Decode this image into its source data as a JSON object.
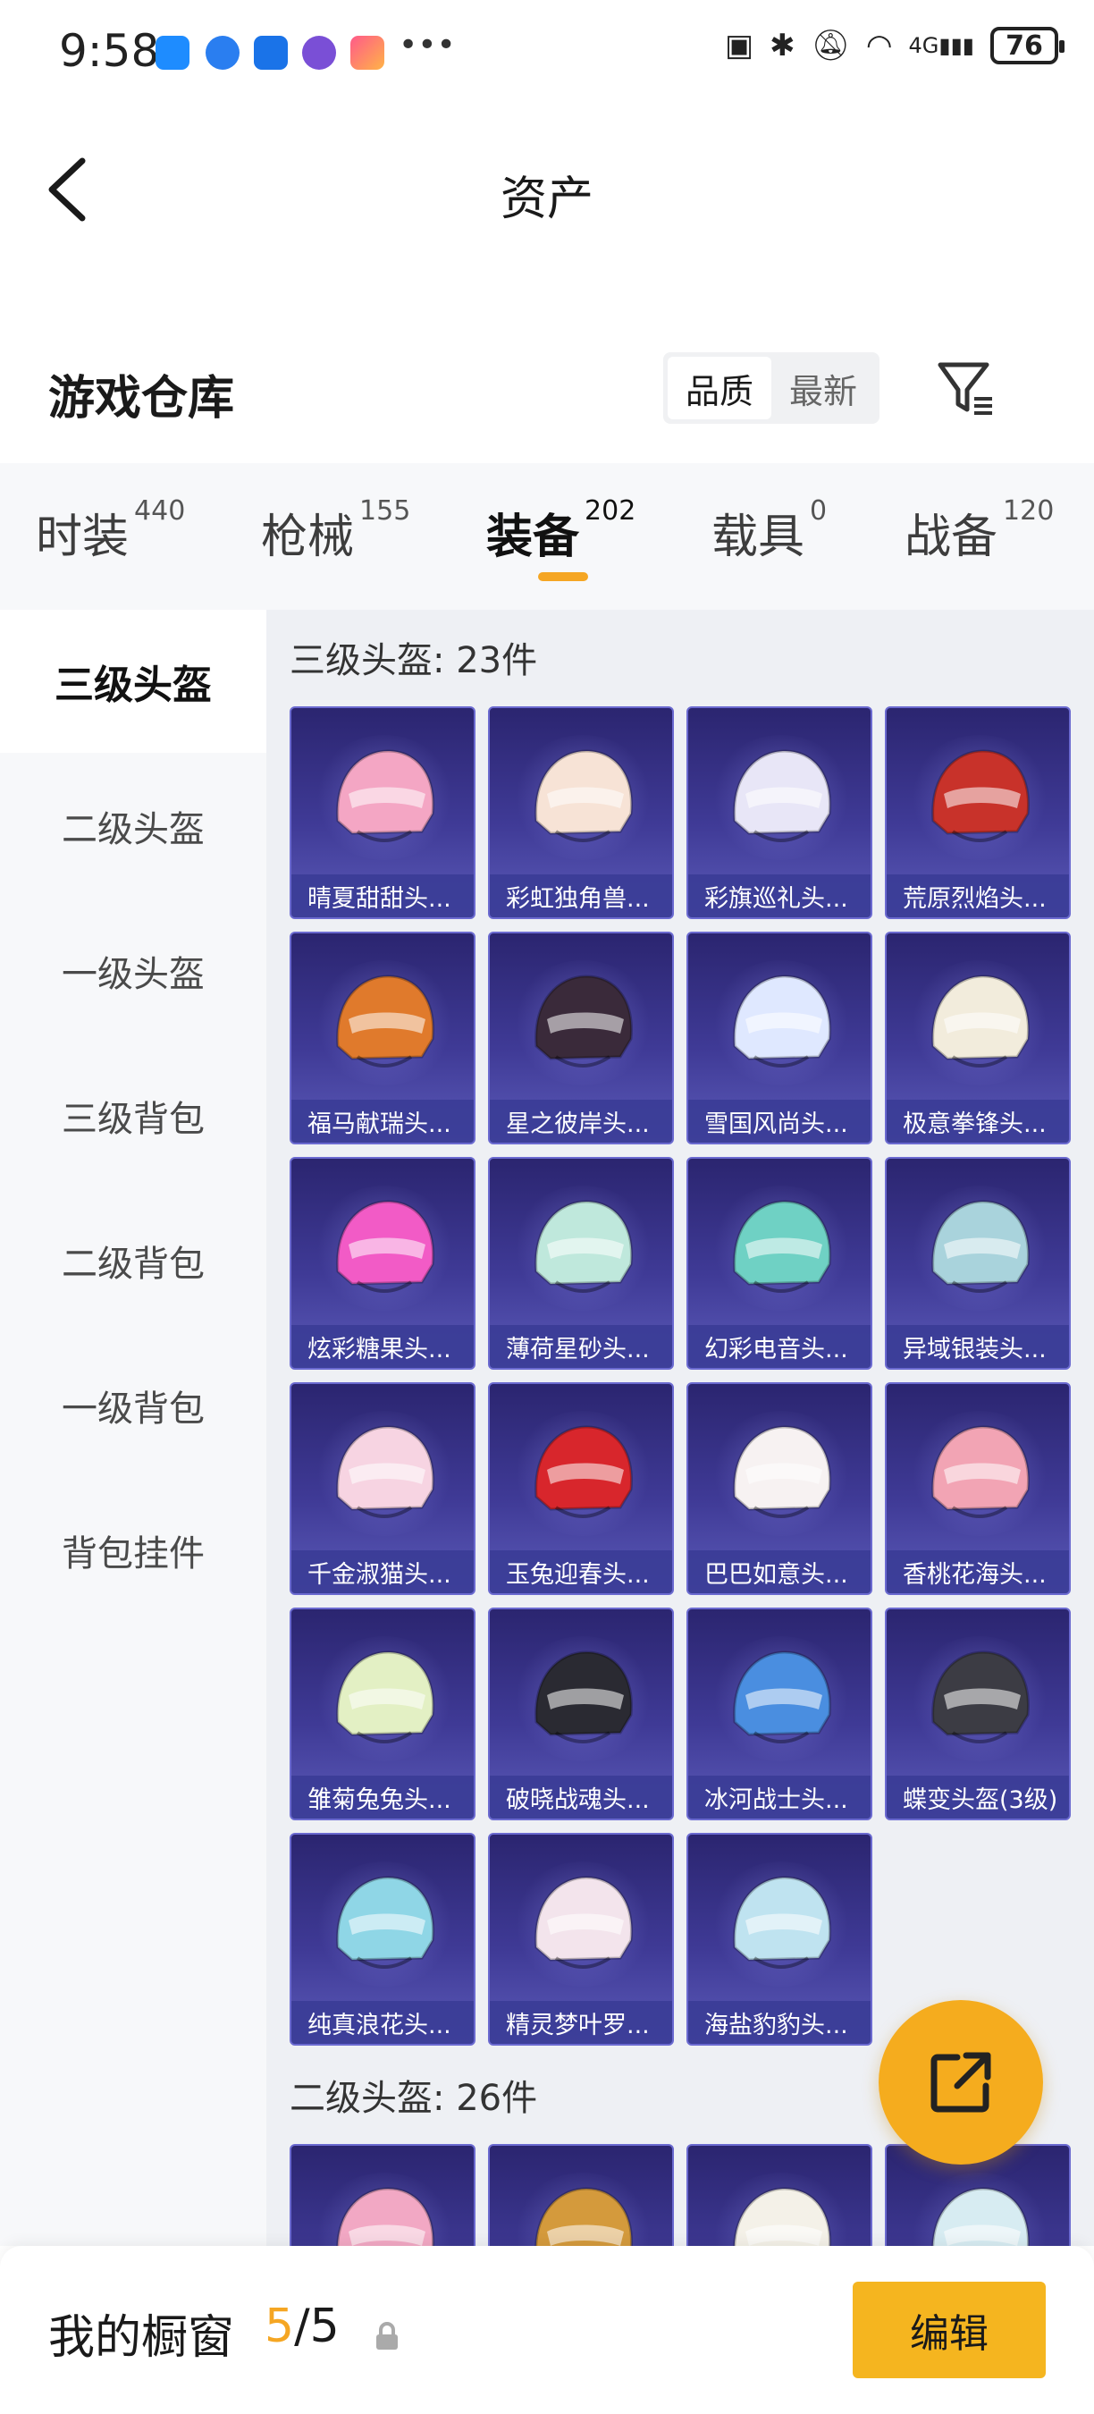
{
  "status_bar": {
    "time": "9:58",
    "signal_label": "4G",
    "battery": "76",
    "app_icon_colors": [
      "#1e8cff",
      "#2a7ef0",
      "#1a73e8",
      "#7a4fd6",
      "#ff5a8a"
    ]
  },
  "header": {
    "title": "资产",
    "back_icon": "chevron-left-icon"
  },
  "section": {
    "title": "游戏仓库",
    "sort_options": [
      "品质",
      "最新"
    ],
    "sort_selected": "品质",
    "filter_icon": "filter-icon"
  },
  "tabs": [
    {
      "label": "时装",
      "count": "440",
      "active": false
    },
    {
      "label": "枪械",
      "count": "155",
      "active": false
    },
    {
      "label": "装备",
      "count": "202",
      "active": true
    },
    {
      "label": "载具",
      "count": "0",
      "active": false
    },
    {
      "label": "战备",
      "count": "120",
      "active": false
    }
  ],
  "sidenav": [
    {
      "label": "三级头盔",
      "active": true
    },
    {
      "label": "二级头盔",
      "active": false
    },
    {
      "label": "一级头盔",
      "active": false
    },
    {
      "label": "三级背包",
      "active": false
    },
    {
      "label": "二级背包",
      "active": false
    },
    {
      "label": "一级背包",
      "active": false
    },
    {
      "label": "背包挂件",
      "active": false
    }
  ],
  "groups": [
    {
      "title": "三级头盔: 23件",
      "items": [
        {
          "name": "晴夏甜甜头...",
          "color": "#f4a6c4"
        },
        {
          "name": "彩虹独角兽...",
          "color": "#f7e3d6"
        },
        {
          "name": "彩旗巡礼头...",
          "color": "#e8e6f7"
        },
        {
          "name": "荒原烈焰头...",
          "color": "#c8322a"
        },
        {
          "name": "福马献瑞头...",
          "color": "#e07a2c"
        },
        {
          "name": "星之彼岸头...",
          "color": "#3a2a3a"
        },
        {
          "name": "雪国风尚头...",
          "color": "#dfe8ff"
        },
        {
          "name": "极意拳锋头...",
          "color": "#f2ecdc"
        },
        {
          "name": "炫彩糖果头...",
          "color": "#f25bc6"
        },
        {
          "name": "薄荷星砂头...",
          "color": "#bfe8dc"
        },
        {
          "name": "幻彩电音头...",
          "color": "#6fd1c4"
        },
        {
          "name": "异域银装头...",
          "color": "#a9d3dc"
        },
        {
          "name": "千金淑猫头...",
          "color": "#f7d4e2"
        },
        {
          "name": "玉兔迎春头...",
          "color": "#d8262c"
        },
        {
          "name": "巴巴如意头...",
          "color": "#f7f2f2"
        },
        {
          "name": "香桃花海头...",
          "color": "#f2a4b4"
        },
        {
          "name": "雏菊兔兔头...",
          "color": "#e3f0c4"
        },
        {
          "name": "破晓战魂头...",
          "color": "#2a2a32"
        },
        {
          "name": "冰河战士头...",
          "color": "#4a8ee0"
        },
        {
          "name": "蝶变头盔(3级)",
          "color": "#3c3c44"
        },
        {
          "name": "纯真浪花头...",
          "color": "#8fd6e6"
        },
        {
          "name": "精灵梦叶罗...",
          "color": "#f3e4ec"
        },
        {
          "name": "海盐豹豹头...",
          "color": "#bfe3f0"
        }
      ]
    },
    {
      "title": "二级头盔: 26件",
      "items": [
        {
          "name": "",
          "color": "#f2a8c4"
        },
        {
          "name": "",
          "color": "#d49a3c"
        },
        {
          "name": "",
          "color": "#f4f1e8"
        },
        {
          "name": "",
          "color": "#d7ecf2"
        }
      ]
    }
  ],
  "share_button_icon": "share-external-icon",
  "bottom": {
    "label": "我的橱窗",
    "current": "5",
    "separator": "/",
    "total": "5",
    "lock_icon": "lock-icon",
    "edit_label": "编辑"
  }
}
